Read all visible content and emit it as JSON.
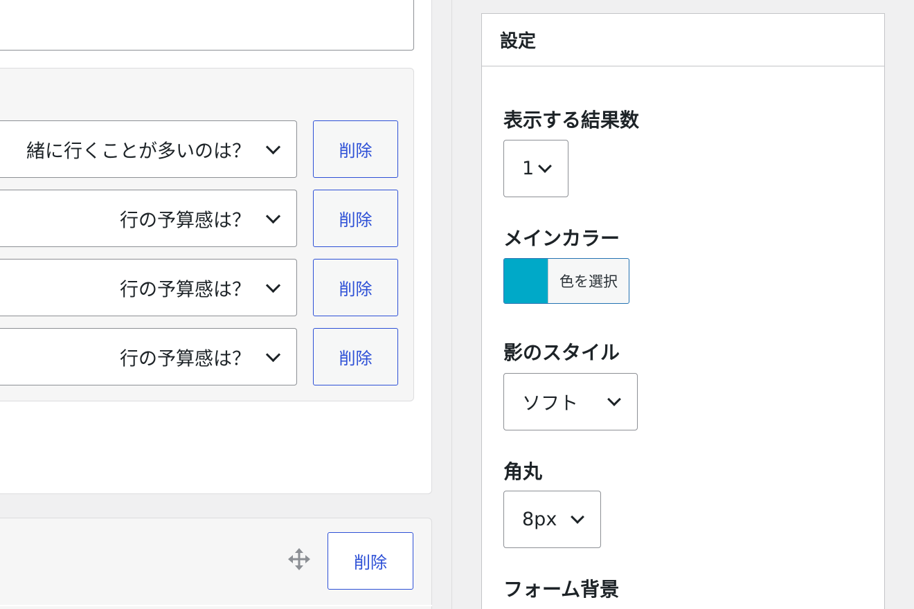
{
  "questions": [
    {
      "text": "緒に行くことが多いのは？",
      "delete_label": "削除"
    },
    {
      "text": "行の予算感は？",
      "delete_label": "削除"
    },
    {
      "text": "行の予算感は？",
      "delete_label": "削除"
    },
    {
      "text": "行の予算感は？",
      "delete_label": "削除"
    }
  ],
  "bottom_block": {
    "delete_label": "削除",
    "move_icon": "move-icon"
  },
  "settings": {
    "title": "設定",
    "results_count": {
      "label": "表示する結果数",
      "value": "1"
    },
    "main_color": {
      "label": "メインカラー",
      "button_label": "色を選択",
      "color": "#00a9c8"
    },
    "shadow_style": {
      "label": "影のスタイル",
      "value": "ソフト"
    },
    "border_radius": {
      "label": "角丸",
      "value": "8px"
    },
    "form_background": {
      "label": "フォーム背景"
    }
  }
}
